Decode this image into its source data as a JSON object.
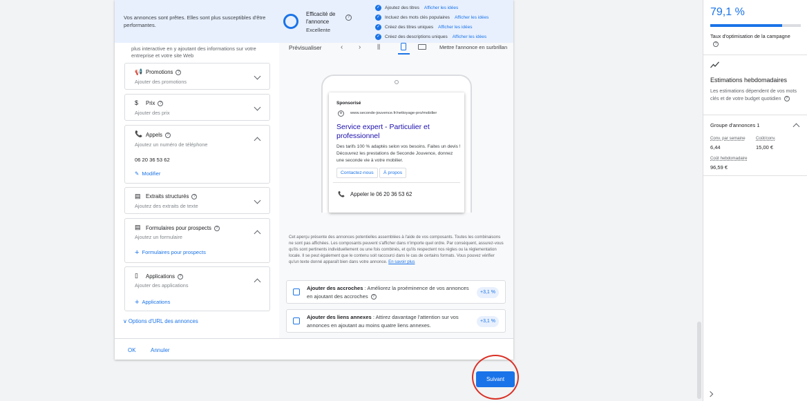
{
  "banner": {
    "message": "Vos annonces sont prêtes. Elles sont plus susceptibles d'être performantes.",
    "effectiveness_title": "Efficacité de l'annonce",
    "effectiveness_level": "Excellente",
    "checklist": [
      {
        "label": "Ajoutez des titres",
        "link": "Afficher les idées"
      },
      {
        "label": "Incluez des mots clés populaires",
        "link": "Afficher les idées"
      },
      {
        "label": "Créez des titres uniques",
        "link": "Afficher les idées"
      },
      {
        "label": "Créez des descriptions uniques",
        "link": "Afficher les idées"
      }
    ]
  },
  "left": {
    "intro": "plus interactive en y ajoutant des informations sur votre entreprise et votre site Web",
    "cards": {
      "promotions": {
        "title": "Promotions",
        "subtitle": "Ajouter des promotions"
      },
      "prix": {
        "title": "Prix",
        "subtitle": "Ajouter des prix"
      },
      "appels": {
        "title": "Appels",
        "subtitle": "Ajoutez un numéro de téléphone",
        "value": "06 20 36 53 62",
        "action": "Modifier"
      },
      "extraits": {
        "title": "Extraits structurés",
        "subtitle": "Ajoutez des extraits de texte"
      },
      "formulaires": {
        "title": "Formulaires pour prospects",
        "subtitle": "Ajoutez un formulaire",
        "action": "Formulaires pour prospects"
      },
      "applications": {
        "title": "Applications",
        "subtitle": "Ajouter des applications",
        "action": "Applications"
      }
    },
    "url_options": "Options d'URL des annonces"
  },
  "preview": {
    "label": "Prévisualiser",
    "highlight_label": "Mettre l'annonce en surbrillan",
    "ad": {
      "sponsored": "Sponsorisé",
      "url": "www.seconde-jouvence.fr/nettoyage-pro/mobilier",
      "headline": "Service expert - Particulier et professionnel",
      "description": "Des tarifs 100 % adaptés selon vos besoins. Faites un devis ! Découvrez les prestations de Seconde Jouvence, donnez une seconde vie à votre mobilier.",
      "chips": [
        "Contactez-nous",
        "À propos"
      ],
      "call": "Appeler le 06 20 36 53 62"
    },
    "disclaimer": "Cet aperçu présente des annonces potentielles assemblées à l'aide de vos composants. Toutes les combinaisons ne sont pas affichées. Les composants peuvent s'afficher dans n'importe quel ordre. Par conséquent, assurez-vous qu'ils sont pertinents individuellement ou une fois combinés, et qu'ils respectent nos règles ou la réglementation locale. Il se peut également que le contenu soit raccourci dans le cas de certains formats. Vous pouvez vérifier qu'un texte donné apparaît bien dans votre annonce.",
    "learn_more": "En savoir plus",
    "suggestions": [
      {
        "title": "Ajouter des accroches",
        "text": " : Améliorez la proéminence de vos annonces en ajoutant des accroches",
        "badge": "+3,1 %"
      },
      {
        "title": "Ajouter des liens annexes",
        "text": " : Attirez davantage l'attention sur vos annonces en ajoutant au moins quatre liens annexes.",
        "badge": "+3,1 %"
      }
    ]
  },
  "footer": {
    "ok": "OK",
    "cancel": "Annuler",
    "next": "Suivant"
  },
  "sidebar": {
    "score": "79,1 %",
    "score_fraction": 0.791,
    "score_label": "Taux d'optimisation de la campagne",
    "estimates_title": "Estimations hebdomadaires",
    "estimates_desc": "Les estimations dépendent de vos mots clés et de votre budget quotidien",
    "group_title": "Groupe d'annonces 1",
    "metrics": [
      {
        "label": "Conv. par semaine",
        "value": "6,44"
      },
      {
        "label": "Coût/conv.",
        "value": "15,00 €"
      },
      {
        "label": "Coût hebdomadaire",
        "value": "96,59 €"
      }
    ]
  },
  "colors": {
    "accent": "#1a73e8",
    "banner_bg": "#e8f0fe",
    "highlight_circle": "#d93025"
  }
}
